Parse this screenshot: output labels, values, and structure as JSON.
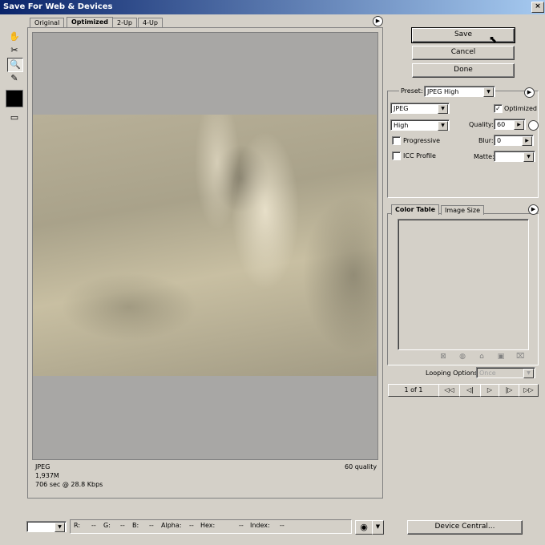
{
  "window": {
    "title": "Save For Web & Devices",
    "minimize": "_",
    "maximize": "□",
    "close": "×"
  },
  "tools": [
    "hand-tool",
    "slice-select-tool",
    "zoom-tool",
    "eyedropper-tool",
    "eyedropper-color",
    "toggle-slices"
  ],
  "tabs": [
    {
      "label": "Original"
    },
    {
      "label": "Optimized",
      "active": true
    },
    {
      "label": "2-Up"
    },
    {
      "label": "4-Up"
    }
  ],
  "image_info": {
    "format": "JPEG",
    "size": "1,937M",
    "time": "706 sec @ 28.8 Kbps",
    "quality": "60 quality"
  },
  "buttons": {
    "save": "Save",
    "cancel": "Cancel",
    "done": "Done",
    "device_central": "Device Central..."
  },
  "settings": {
    "preset_label": "Preset:",
    "preset_value": "JPEG High",
    "format": "JPEG",
    "compression": "High",
    "optimized_label": "Optimized",
    "optimized_checked": true,
    "progressive_label": "Progressive",
    "progressive_checked": false,
    "icc_label": "ICC Profile",
    "icc_checked": false,
    "quality_label": "Quality:",
    "quality_value": "60",
    "blur_label": "Blur:",
    "blur_value": "0",
    "matte_label": "Matte:",
    "matte_value": ""
  },
  "panel_tabs": {
    "color_table": "Color Table",
    "image_size": "Image Size"
  },
  "animation": {
    "looping_label": "Looping Options:",
    "looping_value": "Once",
    "frame_counter": "1 of 1",
    "controls": [
      "◁◁",
      "◁|",
      "▷",
      "|▷",
      "▷▷"
    ]
  },
  "status_bar": {
    "zoom_value": "",
    "r": "R:",
    "r_val": "--",
    "g": "G:",
    "g_val": "--",
    "b": "B:",
    "b_val": "--",
    "alpha": "Alpha:",
    "alpha_val": "--",
    "hex": "Hex:",
    "hex_val": "--",
    "index": "Index:",
    "index_val": "--"
  },
  "colors": {
    "title_start": "#0a246a",
    "title_end": "#a6caf0",
    "chrome": "#d4d0c8",
    "canvas_bg": "#a8a7a5"
  }
}
